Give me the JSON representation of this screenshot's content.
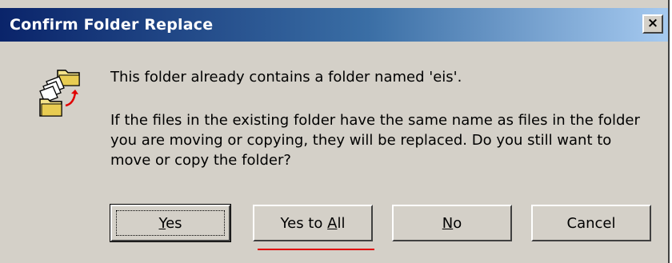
{
  "window": {
    "title": "Confirm Folder Replace",
    "close_label": "×"
  },
  "message": {
    "line1": "This folder already contains a folder named 'eis'.",
    "paragraph": "If the files in the existing folder have the same name as files in the folder you are moving or copying, they will be replaced.  Do you still want to move or copy the folder?"
  },
  "buttons": {
    "yes": {
      "pre": "",
      "accel": "Y",
      "post": "es"
    },
    "yes_to_all": {
      "pre": "Yes to ",
      "accel": "A",
      "post": "ll"
    },
    "no": {
      "pre": "",
      "accel": "N",
      "post": "o"
    },
    "cancel": {
      "label": "Cancel"
    }
  },
  "colors": {
    "dialog_bg": "#d4d0c8",
    "title_start": "#0a246a",
    "title_end": "#a6caf0",
    "highlight_line": "#e00000"
  },
  "icons": {
    "dialog": "folder-replace-icon"
  }
}
